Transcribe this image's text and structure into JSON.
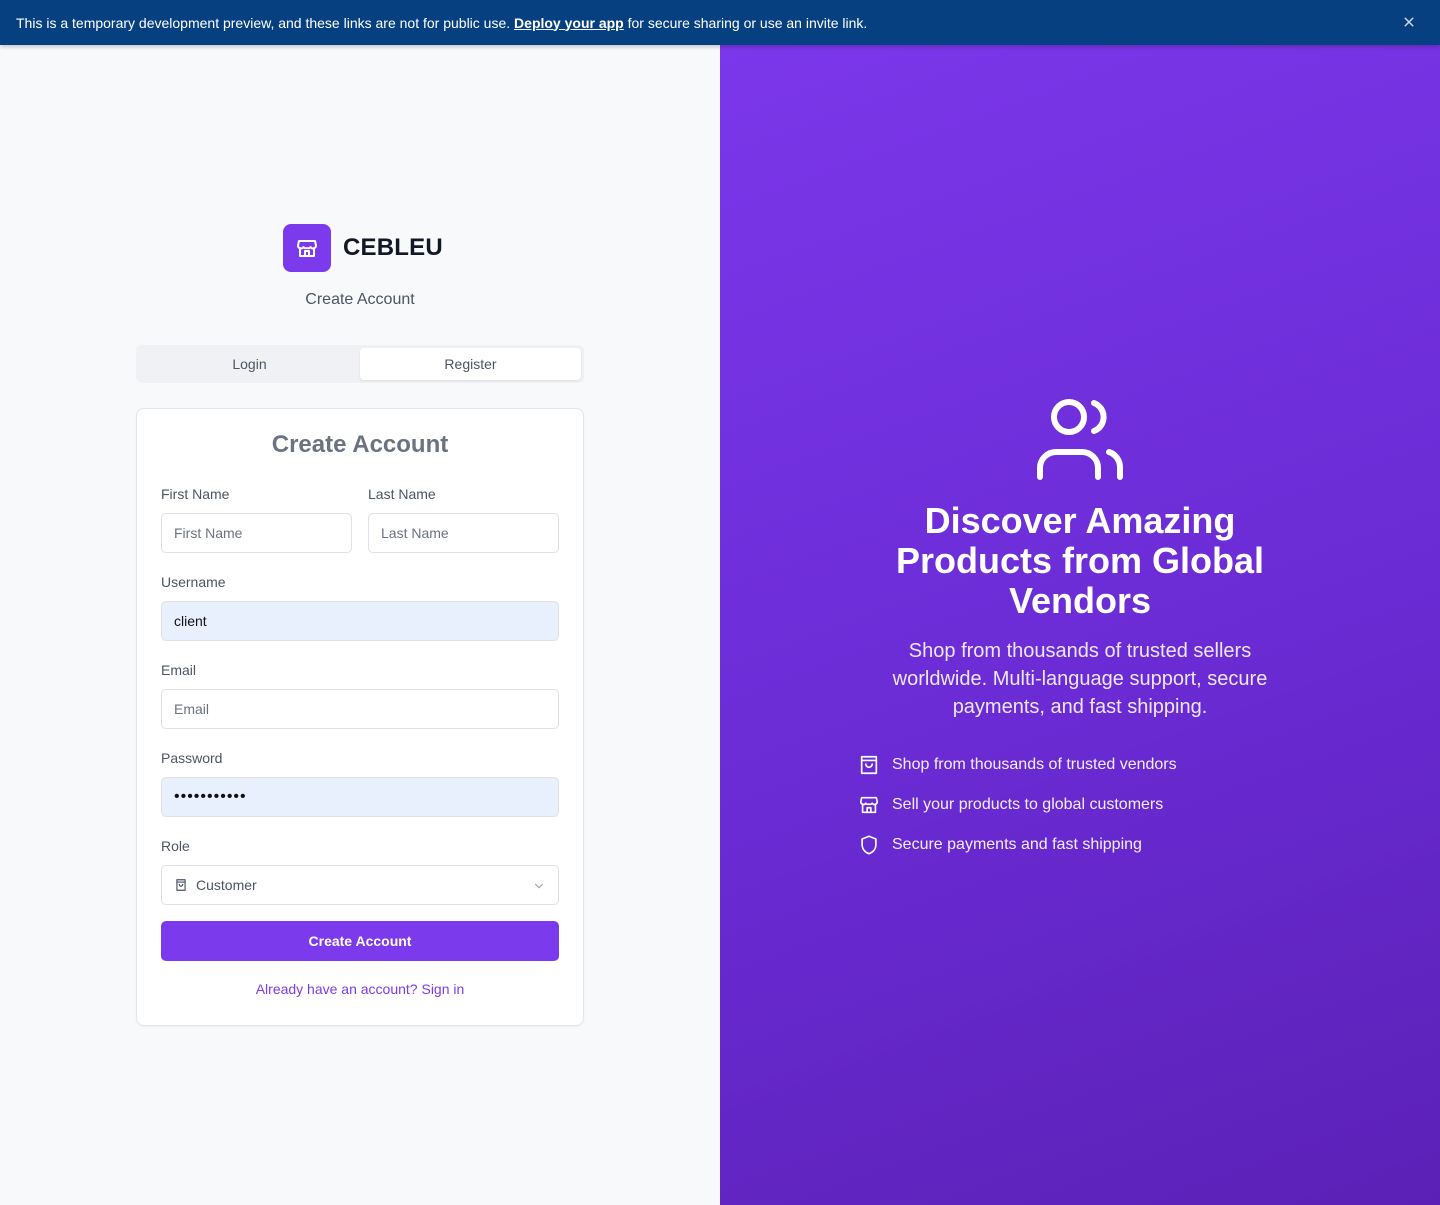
{
  "banner": {
    "text_before": "This is a temporary development preview, and these links are not for public use. ",
    "link": "Deploy your app",
    "text_after": " for secure sharing or use an invite link."
  },
  "brand": {
    "name": "CEBLEU",
    "subtitle": "Create Account"
  },
  "tabs": [
    {
      "label": "Login"
    },
    {
      "label": "Register"
    }
  ],
  "form": {
    "title": "Create Account",
    "first_name": {
      "label": "First Name",
      "placeholder": "First Name",
      "value": ""
    },
    "last_name": {
      "label": "Last Name",
      "placeholder": "Last Name",
      "value": ""
    },
    "username": {
      "label": "Username",
      "value": "client"
    },
    "email": {
      "label": "Email",
      "placeholder": "Email",
      "value": ""
    },
    "password": {
      "label": "Password",
      "value": "•••••••••••"
    },
    "role": {
      "label": "Role",
      "selected": "Customer"
    },
    "submit_label": "Create Account",
    "signin_link": "Already have an account? Sign in"
  },
  "hero": {
    "title": "Discover Amazing Products from Global Vendors",
    "description": "Shop from thousands of trusted sellers worldwide. Multi-language support, secure payments, and fast shipping.",
    "features": [
      {
        "icon": "shopping-bag-icon",
        "text": "Shop from thousands of trusted vendors"
      },
      {
        "icon": "store-icon",
        "text": "Sell your products to global customers"
      },
      {
        "icon": "shield-icon",
        "text": "Secure payments and fast shipping"
      }
    ]
  },
  "colors": {
    "banner": "#064080",
    "accent": "#7c3aed",
    "hero_gradient_start": "#7b37ea",
    "hero_gradient_end": "#5b21b6"
  }
}
